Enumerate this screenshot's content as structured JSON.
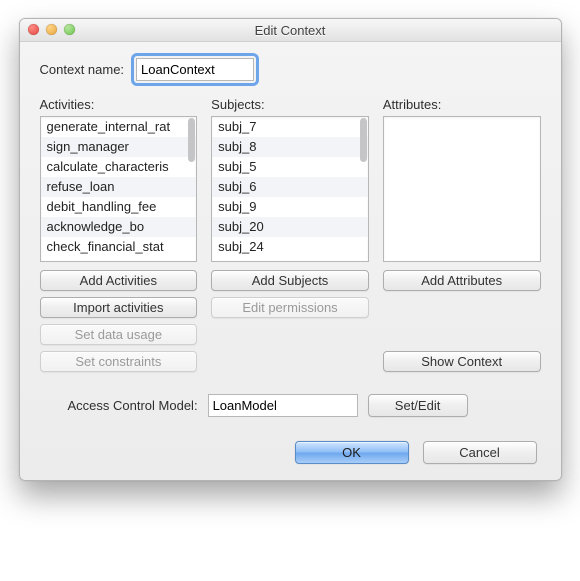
{
  "window": {
    "title": "Edit Context"
  },
  "contextName": {
    "label": "Context name:",
    "value": "LoanContext"
  },
  "columns": {
    "activities": {
      "label": "Activities:",
      "items": [
        "generate_internal_rat",
        "sign_manager",
        "calculate_characteris",
        "refuse_loan",
        "debit_handling_fee",
        "acknowledge_bo",
        "check_financial_stat"
      ],
      "buttons": {
        "add": "Add Activities",
        "import": "Import activities",
        "dataUsage": "Set data usage",
        "constraints": "Set constraints"
      }
    },
    "subjects": {
      "label": "Subjects:",
      "items": [
        "subj_7",
        "subj_8",
        "subj_5",
        "subj_6",
        "subj_9",
        "subj_20",
        "subj_24"
      ],
      "buttons": {
        "add": "Add Subjects",
        "edit": "Edit permissions"
      }
    },
    "attributes": {
      "label": "Attributes:",
      "items": [],
      "buttons": {
        "add": "Add Attributes",
        "show": "Show Context"
      }
    }
  },
  "acm": {
    "label": "Access Control Model:",
    "value": "LoanModel",
    "button": "Set/Edit"
  },
  "footer": {
    "ok": "OK",
    "cancel": "Cancel"
  }
}
